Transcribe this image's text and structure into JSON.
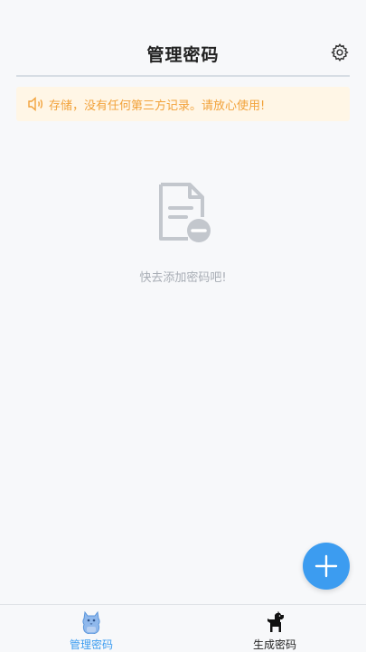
{
  "header": {
    "title": "管理密码",
    "settings_icon": "gear-icon"
  },
  "notice": {
    "icon": "speaker-icon",
    "text": "存储，没有任何第三方记录。请放心使用!"
  },
  "empty_state": {
    "icon": "document-remove-icon",
    "message": "快去添加密码吧!"
  },
  "fab": {
    "icon": "plus-icon"
  },
  "tabbar": {
    "items": [
      {
        "label": "管理密码",
        "icon": "cat-icon",
        "active": true
      },
      {
        "label": "生成密码",
        "icon": "dog-icon",
        "active": false
      }
    ]
  },
  "colors": {
    "accent": "#3c9cf0",
    "notice_bg": "#fff6e6",
    "notice_text": "#f2a23a",
    "background": "#f7f8fa"
  }
}
